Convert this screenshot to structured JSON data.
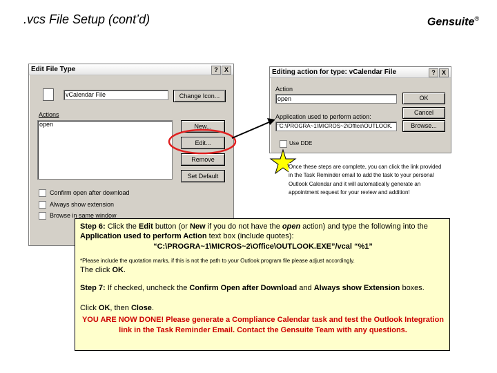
{
  "header": {
    "title": ".vcs File Setup (cont’d)",
    "brand": "Gensuite",
    "brand_reg": "®"
  },
  "edit_file_type_dialog": {
    "title": "Edit File Type",
    "help_btn": "?",
    "close_btn": "X",
    "description_value": "vCalendar File",
    "change_icon": "Change Icon...",
    "actions_label": "Actions",
    "actions_list": [
      "open"
    ],
    "new_btn": "New...",
    "edit_btn": "Edit...",
    "remove_btn": "Remove",
    "set_default_btn": "Set Default",
    "confirm_open": "Confirm open after download",
    "always_show_ext": "Always show extension",
    "browse_same_window": "Browse in same window"
  },
  "editing_action_dialog": {
    "title": "Editing action for type: vCalendar File",
    "help_btn": "?",
    "close_btn": "X",
    "action_label": "Action",
    "action_value": "open",
    "ok_btn": "OK",
    "cancel_btn": "Cancel",
    "app_label": "Application used to perform action:",
    "app_value": "\"C:\\PROGRA~1\\MICROS~2\\Office\\OUTLOOK.",
    "browse_btn": "Browse...",
    "use_dde": "Use DDE"
  },
  "note": "Once these steps are complete, you can click the link provided in the Task Reminder email to add the task to your personal Outlook Calendar and it will automatically generate an appointment request for your review and addition!",
  "instructions": {
    "step6_label": "Step 6:",
    "step6_a": " Click the ",
    "step6_edit": "Edit",
    "step6_b": " button (or ",
    "step6_new": "New",
    "step6_c": " if you do not have the ",
    "step6_open": "open",
    "step6_d": " action) and type the following into the ",
    "step6_app": "Application used to perform Action",
    "step6_e": " text box (include quotes):",
    "command": "“C:\\PROGRA~1\\MICROS~2\\Office\\OUTLOOK.EXE”/vcal “%1”",
    "footnote": "*Please include the quotation marks, if this is not the path to your Outlook program file please adjust accordingly.",
    "click_ok_a": "The click ",
    "click_ok_b": "OK",
    "click_ok_c": ".",
    "step7_label": "Step 7:",
    "step7_a": " If checked, uncheck the ",
    "step7_confirm": "Confirm Open after Download",
    "step7_b": " and ",
    "step7_always": "Always show Extension",
    "step7_c": " boxes.",
    "step7_click_a": "Click ",
    "step7_ok": "OK",
    "step7_click_b": ", then ",
    "step7_close": "Close",
    "step7_click_c": ".",
    "done": "YOU ARE NOW DONE!  Please generate a Compliance Calendar task and test the Outlook Integration link in the Task Reminder Email.  Contact the Gensuite Team with any questions."
  },
  "colors": {
    "highlight_red": "#e02020",
    "note_box": "#ffffcc",
    "star": "#ffff00"
  }
}
